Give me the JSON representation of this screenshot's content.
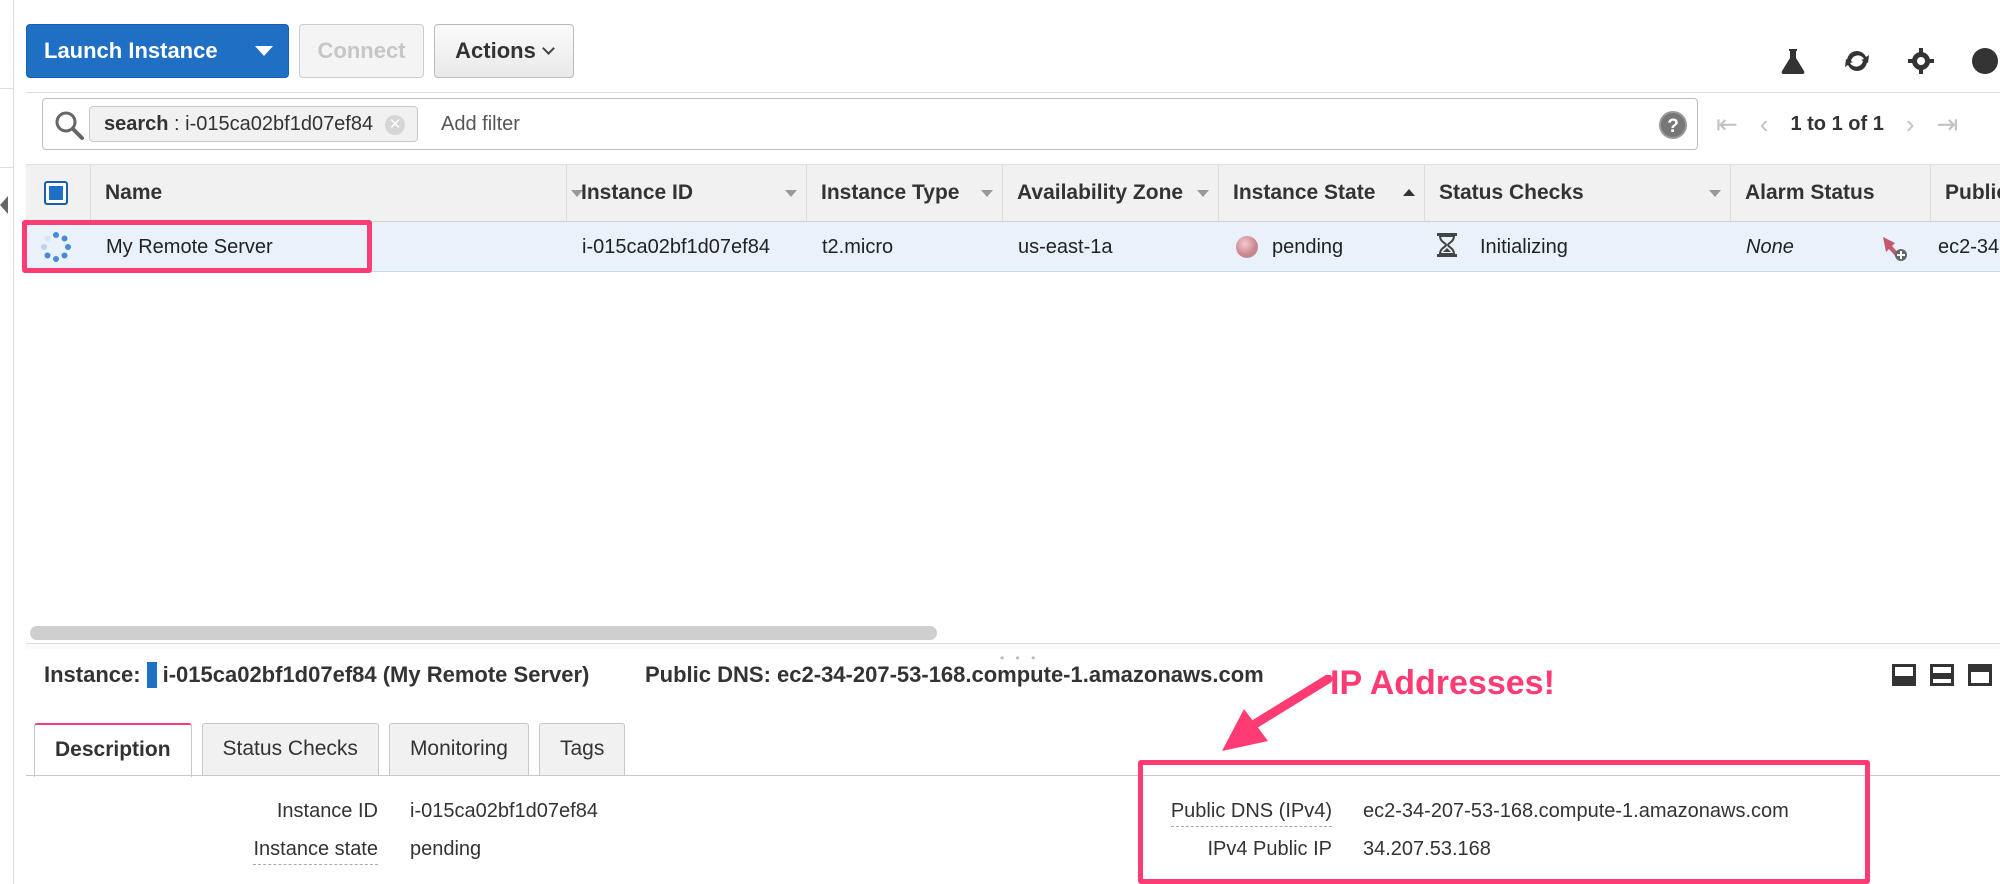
{
  "toolbar": {
    "launch_label": "Launch Instance",
    "connect_label": "Connect",
    "actions_label": "Actions"
  },
  "top_icons": [
    "flask-icon",
    "refresh-icon",
    "gear-icon",
    "help-icon"
  ],
  "filter": {
    "token_key": "search",
    "token_sep": " : ",
    "token_value": "i-015ca02bf1d07ef84",
    "placeholder": "Add filter"
  },
  "pager": {
    "text": "1 to 1 of 1"
  },
  "table": {
    "columns": [
      "Name",
      "Instance ID",
      "Instance Type",
      "Availability Zone",
      "Instance State",
      "Status Checks",
      "Alarm Status",
      "Public"
    ],
    "row": {
      "name": "My Remote Server",
      "instance_id": "i-015ca02bf1d07ef84",
      "instance_type": "t2.micro",
      "availability_zone": "us-east-1a",
      "instance_state": "pending",
      "status_checks": "Initializing",
      "alarm_status": "None",
      "public": "ec2-34"
    }
  },
  "detail": {
    "instance_label": "Instance:",
    "instance_value": "i-015ca02bf1d07ef84 (My Remote Server)",
    "public_dns_label": "Public DNS:",
    "public_dns_value": "ec2-34-207-53-168.compute-1.amazonaws.com",
    "tabs": [
      "Description",
      "Status Checks",
      "Monitoring",
      "Tags"
    ],
    "left": [
      {
        "label": "Instance ID",
        "value": "i-015ca02bf1d07ef84"
      },
      {
        "label": "Instance state",
        "value": "pending"
      }
    ],
    "right": [
      {
        "label": "Public DNS (IPv4)",
        "value": "ec2-34-207-53-168.compute-1.amazonaws.com"
      },
      {
        "label": "IPv4 Public IP",
        "value": "34.207.53.168"
      }
    ]
  },
  "annotation": {
    "text": "IP Addresses!",
    "color": "#ff3b74"
  },
  "colors": {
    "primary": "#1f6fc5",
    "annotation": "#ff3b74",
    "row_selected": "#e9f1fb"
  }
}
